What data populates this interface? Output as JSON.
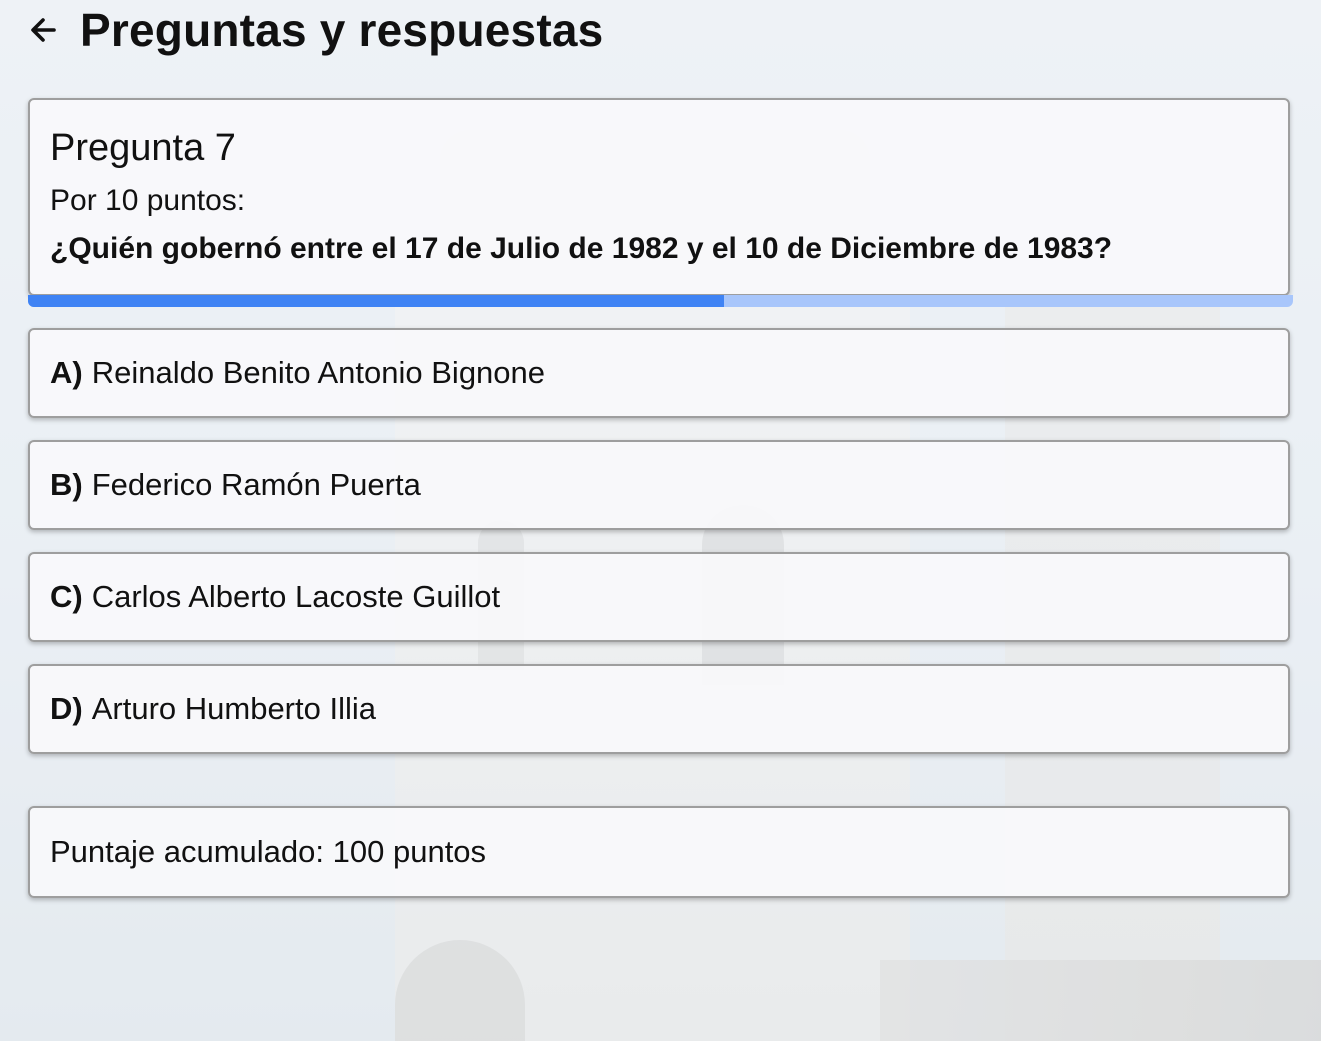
{
  "header": {
    "back_icon": "arrow-left-icon",
    "title": "Preguntas y respuestas"
  },
  "question": {
    "number_label": "Pregunta 7",
    "points_label": "Por 10 puntos:",
    "text": "¿Quién gobernó entre el 17 de Julio de 1982 y el 10 de Diciembre de 1983?"
  },
  "progress": {
    "fraction": 0.55,
    "color_fill": "#3f83f4",
    "color_track": "#a8c6fb"
  },
  "options": [
    {
      "letter": "A)",
      "text": "Reinaldo Benito Antonio Bignone"
    },
    {
      "letter": "B)",
      "text": "Federico Ramón Puerta"
    },
    {
      "letter": "C)",
      "text": "Carlos Alberto Lacoste Guillot"
    },
    {
      "letter": "D)",
      "text": "Arturo Humberto Illia"
    }
  ],
  "score": {
    "text": "Puntaje acumulado: 100 puntos"
  }
}
